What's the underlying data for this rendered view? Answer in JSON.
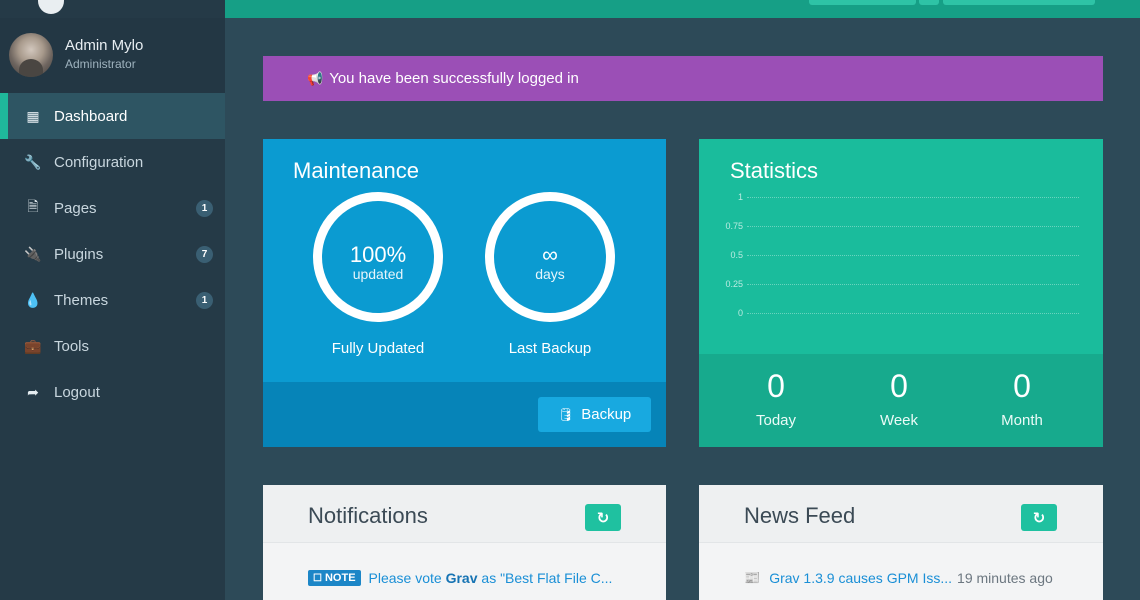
{
  "user": {
    "name": "Admin Mylo",
    "role": "Administrator"
  },
  "nav": {
    "items": [
      {
        "label": "Dashboard",
        "icon": "grid-icon",
        "glyph": "▦",
        "active": true
      },
      {
        "label": "Configuration",
        "icon": "wrench-icon",
        "glyph": "🔧"
      },
      {
        "label": "Pages",
        "icon": "file-icon",
        "glyph": "🗎",
        "badge": "1"
      },
      {
        "label": "Plugins",
        "icon": "plug-icon",
        "glyph": "🔌",
        "badge": "7"
      },
      {
        "label": "Themes",
        "icon": "tint-icon",
        "glyph": "💧",
        "badge": "1"
      },
      {
        "label": "Tools",
        "icon": "briefcase-icon",
        "glyph": "💼"
      },
      {
        "label": "Logout",
        "icon": "sign-out-icon",
        "glyph": "➦"
      }
    ]
  },
  "alert": {
    "text": "You have been successfully logged in",
    "icon": "megaphone-icon",
    "color": "#9b4fb6"
  },
  "maintenance": {
    "title": "Maintenance",
    "updated": {
      "value": "100%",
      "unit": "updated",
      "caption": "Fully Updated",
      "percent": 100
    },
    "backup": {
      "value": "∞",
      "unit": "days",
      "caption": "Last Backup"
    },
    "backup_button": "Backup",
    "color": "#0b9bd1"
  },
  "statistics": {
    "title": "Statistics",
    "ticks": [
      "1",
      "0.75",
      "0.5",
      "0.25",
      "0"
    ],
    "today": {
      "value": "0",
      "label": "Today"
    },
    "week": {
      "value": "0",
      "label": "Week"
    },
    "month": {
      "value": "0",
      "label": "Month"
    },
    "color": "#1abc9c"
  },
  "notifications": {
    "title": "Notifications",
    "items": [
      {
        "badge": "NOTE",
        "text_pre": "Please vote ",
        "text_bold": "Grav",
        "text_post": " as \"Best Flat File C..."
      }
    ]
  },
  "news": {
    "title": "News Feed",
    "items": [
      {
        "text": "Grav 1.3.9 causes GPM Iss...",
        "time": "19 minutes ago"
      }
    ]
  }
}
